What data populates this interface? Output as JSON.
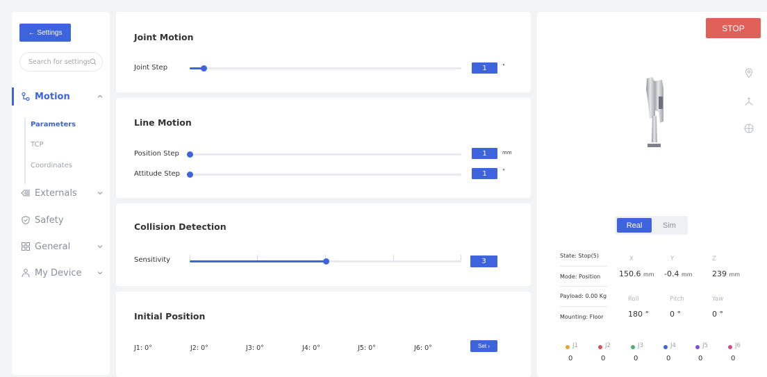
{
  "sidebar": {
    "back_label": "← Settings",
    "search_placeholder": "Search for settings",
    "nav": [
      {
        "label": "Motion",
        "icon": "motion-icon",
        "active": true
      },
      {
        "label": "Externals",
        "icon": "externals-icon"
      },
      {
        "label": "Safety",
        "icon": "shield-icon"
      },
      {
        "label": "General",
        "icon": "grid-icon"
      },
      {
        "label": "My Device",
        "icon": "user-icon"
      }
    ],
    "sub_items": [
      "Parameters",
      "TCP",
      "Coordinates"
    ]
  },
  "joint_motion": {
    "title": "Joint Motion",
    "step_label": "Joint Step",
    "step_value": "1",
    "step_unit": "°",
    "slider_fraction": 0.05
  },
  "line_motion": {
    "title": "Line Motion",
    "position_label": "Position Step",
    "position_value": "1",
    "position_unit": "mm",
    "position_fraction": 0.0,
    "attitude_label": "Attitude Step",
    "attitude_value": "1",
    "attitude_unit": "°",
    "attitude_fraction": 0.0
  },
  "collision": {
    "title": "Collision Detection",
    "sensitivity_label": "Sensitivity",
    "sensitivity_value": "3",
    "sensitivity_fraction": 0.5
  },
  "initial_position": {
    "title": "Initial Position",
    "joints": [
      "J1: 0°",
      "J2: 0°",
      "J3: 0°",
      "J4: 0°",
      "J5: 0°",
      "J6: 0°"
    ],
    "set_label": "Set ›"
  },
  "panel": {
    "stop_label": "STOP",
    "real_label": "Real",
    "sim_label": "Sim",
    "status": {
      "state": "State: Stop(5)",
      "mode": "Mode: Position",
      "payload": "Payload: 0.00 Kg",
      "mounting": "Mounting: Floor"
    },
    "pose": {
      "x_label": "X",
      "x_value": "150.6",
      "x_unit": "mm",
      "y_label": "Y",
      "y_value": "-0.4",
      "y_unit": "mm",
      "z_label": "Z",
      "z_value": "239",
      "z_unit": "mm",
      "roll_label": "Roll",
      "roll_value": "180 °",
      "pitch_label": "Pitch",
      "pitch_value": "0 °",
      "yaw_label": "Yaw",
      "yaw_value": "0 °"
    },
    "joints": [
      {
        "label": "J1",
        "value": "0",
        "color": "#e8a23a"
      },
      {
        "label": "J2",
        "value": "0",
        "color": "#d9534f"
      },
      {
        "label": "J3",
        "value": "0",
        "color": "#4cae6a"
      },
      {
        "label": "J4",
        "value": "0",
        "color": "#3d63dd"
      },
      {
        "label": "J5",
        "value": "0",
        "color": "#7b4fe0"
      },
      {
        "label": "J6",
        "value": "0",
        "color": "#d04a8c"
      }
    ]
  },
  "colors": {
    "accent": "#3d63dd",
    "stop": "#e0605a"
  }
}
